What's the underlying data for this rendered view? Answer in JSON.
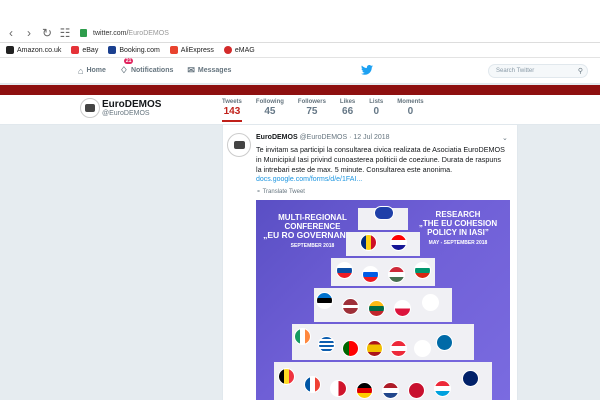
{
  "browser": {
    "url_domain": "twitter.com/",
    "url_path": "EuroDEMOS",
    "bookmarks": [
      {
        "label": "Amazon.co.uk",
        "color": "#222"
      },
      {
        "label": "eBay",
        "color": "#e53238"
      },
      {
        "label": "Booking.com",
        "color": "#1a3f8f"
      },
      {
        "label": "AliExpress",
        "color": "#e8432e"
      },
      {
        "label": "eMAG",
        "color": "#d32a2a"
      }
    ]
  },
  "twitter_nav": {
    "home": "Home",
    "notifications": "Notifications",
    "notification_count": "21",
    "messages": "Messages",
    "search_placeholder": "Search Twitter"
  },
  "profile": {
    "name": "EuroDEMOS",
    "handle": "@EuroDEMOS",
    "stats": [
      {
        "label": "Tweets",
        "value": "143"
      },
      {
        "label": "Following",
        "value": "45"
      },
      {
        "label": "Followers",
        "value": "75"
      },
      {
        "label": "Likes",
        "value": "66"
      },
      {
        "label": "Lists",
        "value": "0"
      },
      {
        "label": "Moments",
        "value": "0"
      }
    ]
  },
  "tweet": {
    "name": "EuroDEMOS",
    "meta": "@EuroDEMOS · 12 Jul 2018",
    "text": "Te invitam sa participi la consultarea civica realizata de Asociatia EuroDEMOS in Municipiul Iasi privind cunoasterea politicii de coeziune. Durata de raspuns la intrebari este de max. 5 minute. Consultarea este anonima.",
    "link": "docs.google.com/forms/d/e/1FAI...",
    "translate": "Translate Tweet",
    "image": {
      "left_title_1": "MULTI-REGIONAL",
      "left_title_2": "CONFERENCE",
      "left_title_3": "„EU RO GOVERNANCE”",
      "left_date": "SEPTEMBER 2018",
      "right_title_1": "RESEARCH",
      "right_title_2": "„THE EU COHESION",
      "right_title_3": "POLICY IN IASI”",
      "right_date": "MAY - SEPTEMBER 2018"
    }
  },
  "colors": {
    "banner": "#8e1010",
    "active_stat": "#c0201a",
    "link": "#1b95e0",
    "twitter_blue": "#1da1f2"
  }
}
